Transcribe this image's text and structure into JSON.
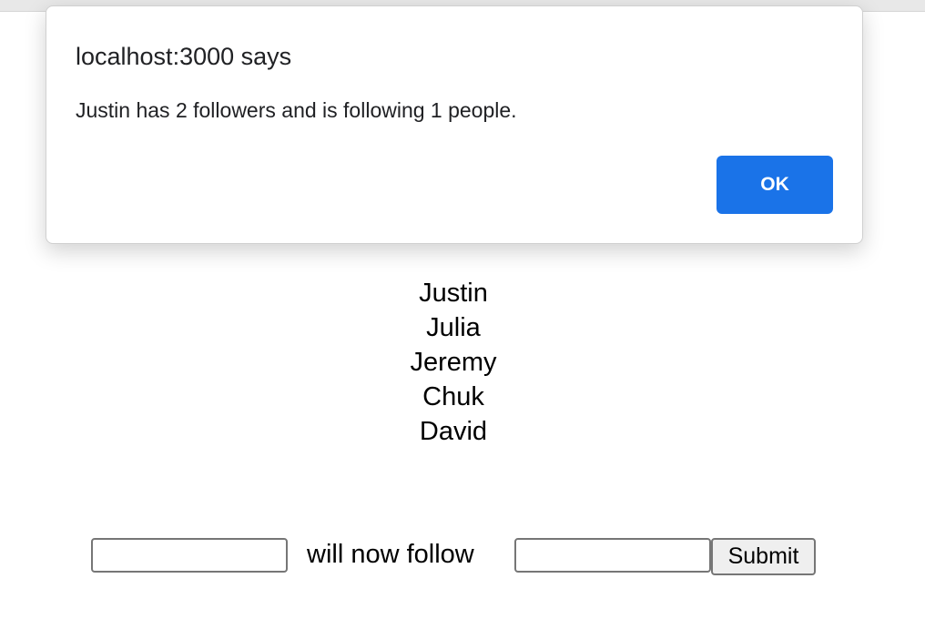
{
  "dialog": {
    "title": "localhost:3000 says",
    "message": "Justin has 2 followers and is following 1 people.",
    "ok_label": "OK"
  },
  "users": [
    "Justin",
    "Julia",
    "Jeremy",
    "Chuk",
    "David"
  ],
  "form": {
    "follower_value": "",
    "connector_label": "will now follow",
    "followee_value": "",
    "submit_label": "Submit"
  }
}
